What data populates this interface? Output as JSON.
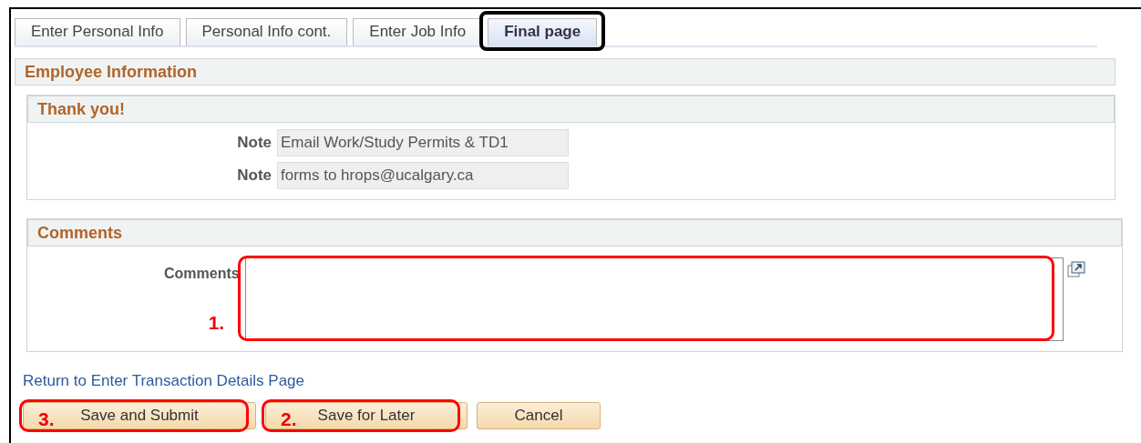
{
  "tabs": [
    {
      "label": "Enter Personal Info",
      "selected": false,
      "highlighted": false
    },
    {
      "label": "Personal Info cont.",
      "selected": false,
      "highlighted": false
    },
    {
      "label": "Enter Job Info",
      "selected": false,
      "highlighted": false
    },
    {
      "label": "Final page",
      "selected": true,
      "highlighted": true
    }
  ],
  "panel_title": "Employee Information",
  "thank_you": {
    "title": "Thank you!",
    "notes": [
      {
        "label": "Note",
        "value": "Email Work/Study Permits & TD1"
      },
      {
        "label": "Note",
        "value": "forms to hrops@ucalgary.ca"
      }
    ]
  },
  "comments": {
    "title": "Comments",
    "label": "Comments",
    "step": "1."
  },
  "return_link": "Return to Enter Transaction Details Page",
  "buttons": [
    {
      "label": "Save and Submit",
      "step": "3."
    },
    {
      "label": "Save for Later",
      "step": "2."
    },
    {
      "label": "Cancel"
    }
  ]
}
